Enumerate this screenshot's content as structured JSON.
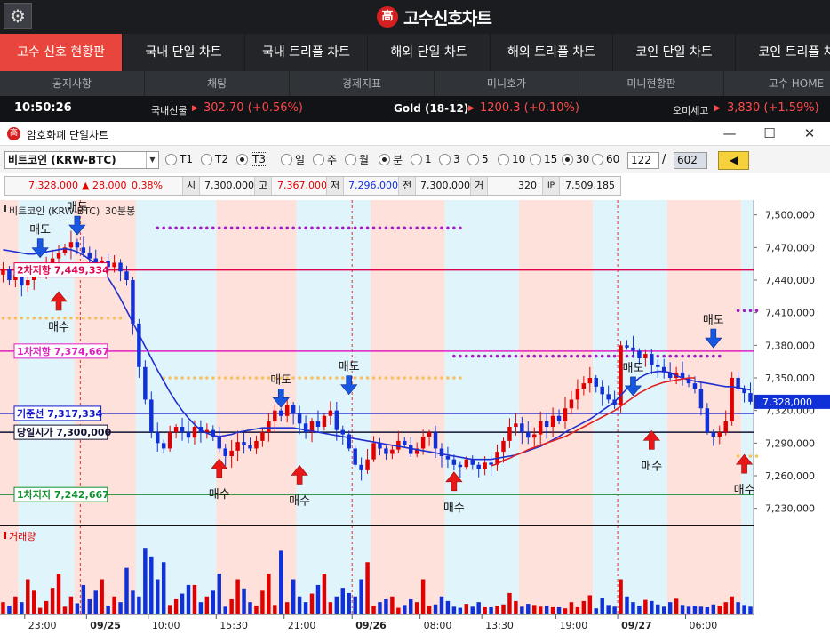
{
  "app": {
    "title": "고수신호차트",
    "logo_char": "高"
  },
  "menu": [
    {
      "label": "고수 신호 현황판",
      "active": true
    },
    {
      "label": "국내 단일 차트"
    },
    {
      "label": "국내 트리플 차트"
    },
    {
      "label": "해외 단일 차트"
    },
    {
      "label": "해외 트리플 차트"
    },
    {
      "label": "코인 단일 차트"
    },
    {
      "label": "코인 트리플 차"
    }
  ],
  "submenu": [
    "공지사항",
    "채팅",
    "경제지표",
    "미니호가",
    "미니현황판",
    "고수 HOME"
  ],
  "ticker": {
    "time": "10:50:26",
    "items": [
      {
        "label": "국내선물",
        "arrow": "▶",
        "value": "302.70 (+0.56%)"
      },
      {
        "label": "Gold (18-12)",
        "arrow": "▶",
        "value": "1200.3 (+0.10%)"
      },
      {
        "label": "오미세고",
        "arrow": "▶",
        "value": "3,830 (+1.59%)"
      }
    ]
  },
  "window": {
    "title": "암호화폐 단일차트",
    "icon_char": "高",
    "min": "—",
    "max": "☐",
    "close": "✕"
  },
  "toolbar": {
    "symbol": "비트코인 (KRW-BTC)",
    "dropdown": "▼",
    "ticks": [
      {
        "label": "T1"
      },
      {
        "label": "T2"
      },
      {
        "label": "T3",
        "checked": true
      }
    ],
    "periods": [
      {
        "label": "일"
      },
      {
        "label": "주"
      },
      {
        "label": "월"
      },
      {
        "label": "분",
        "checked": true
      }
    ],
    "minutes": [
      {
        "label": "1"
      },
      {
        "label": "3"
      },
      {
        "label": "5"
      },
      {
        "label": "10"
      },
      {
        "label": "15"
      },
      {
        "label": "30",
        "checked": true
      },
      {
        "label": "60"
      }
    ],
    "count": "122",
    "total": "602",
    "back": "◀"
  },
  "quote": {
    "price": "7,328,000",
    "change": "▲ 28,000",
    "pct": "0.38%",
    "open_label": "시",
    "open": "7,300,000",
    "high_label": "고",
    "high": "7,367,000",
    "low_label": "저",
    "low": "7,296,000",
    "prev_label": "전",
    "prev": "7,300,000",
    "vol_label": "거",
    "vol": "320",
    "amount_icon": "IP",
    "amount": "7,509,185"
  },
  "chart": {
    "legend_name": "비트코인 (KRW-BTC)",
    "legend_period": "30분봉",
    "volume_label": "거래량",
    "current_price_label": "7,328,000"
  },
  "colors": {
    "up": "#e00000",
    "down": "#1030d8",
    "ma": "#2030d0",
    "ma2": "#e02020",
    "resistance2": "#e00050",
    "resistance1": "#e020c0",
    "base": "#1018c8",
    "open": "#111133",
    "support1": "#109030",
    "shade_pink": "#fde1da",
    "shade_blue": "#e0f4fb"
  },
  "chart_data": {
    "type": "candlestick",
    "price_ylim": [
      7215000,
      7512000
    ],
    "price_ticks": [
      "7,500,000",
      "7,470,000",
      "7,440,000",
      "7,410,000",
      "7,380,000",
      "7,350,000",
      "7,320,000",
      "7,290,000",
      "7,260,000",
      "7,230,000"
    ],
    "x_labels": [
      {
        "i": 4,
        "label": "23:00",
        "bold": false
      },
      {
        "i": 14,
        "label": "09/25",
        "bold": true
      },
      {
        "i": 24,
        "label": "10:00",
        "bold": false
      },
      {
        "i": 35,
        "label": "15:30",
        "bold": false
      },
      {
        "i": 46,
        "label": "21:00",
        "bold": false
      },
      {
        "i": 57,
        "label": "09/26",
        "bold": true
      },
      {
        "i": 68,
        "label": "08:00",
        "bold": false
      },
      {
        "i": 78,
        "label": "13:30",
        "bold": false
      },
      {
        "i": 90,
        "label": "19:00",
        "bold": false
      },
      {
        "i": 100,
        "label": "09/27",
        "bold": true
      },
      {
        "i": 111,
        "label": "06:00",
        "bold": false
      }
    ],
    "closes": [
      7450000,
      7440000,
      7445000,
      7435000,
      7440000,
      7445000,
      7445000,
      7455000,
      7460000,
      7465000,
      7470000,
      7475000,
      7470000,
      7465000,
      7460000,
      7455000,
      7458000,
      7452000,
      7456000,
      7448000,
      7440000,
      7400000,
      7360000,
      7330000,
      7300000,
      7290000,
      7285000,
      7300000,
      7305000,
      7300000,
      7295000,
      7305000,
      7300000,
      7302000,
      7296000,
      7285000,
      7278000,
      7283000,
      7291000,
      7288000,
      7285000,
      7292000,
      7300000,
      7310000,
      7320000,
      7315000,
      7325000,
      7318000,
      7308000,
      7300000,
      7310000,
      7305000,
      7315000,
      7320000,
      7302000,
      7298000,
      7285000,
      7270000,
      7265000,
      7275000,
      7290000,
      7285000,
      7280000,
      7284000,
      7292000,
      7288000,
      7280000,
      7285000,
      7296000,
      7300000,
      7285000,
      7278000,
      7275000,
      7270000,
      7268000,
      7275000,
      7270000,
      7266000,
      7272000,
      7270000,
      7282000,
      7292000,
      7305000,
      7308000,
      7300000,
      7295000,
      7298000,
      7310000,
      7305000,
      7315000,
      7310000,
      7322000,
      7330000,
      7340000,
      7345000,
      7350000,
      7342000,
      7335000,
      7330000,
      7325000,
      7380000,
      7378000,
      7375000,
      7368000,
      7372000,
      7362000,
      7360000,
      7355000,
      7350000,
      7355000,
      7350000,
      7345000,
      7340000,
      7322000,
      7300000,
      7296000,
      7300000,
      7310000,
      7350000,
      7340000,
      7336000,
      7328000
    ],
    "ma": [
      7468000,
      7467000,
      7466000,
      7465000,
      7464000,
      7464000,
      7465000,
      7466000,
      7467000,
      7468000,
      7469000,
      7468000,
      7466000,
      7463000,
      7459000,
      7455000,
      7450000,
      7442000,
      7433000,
      7423000,
      7412000,
      7401000,
      7390000,
      7379000,
      7368000,
      7357000,
      7347000,
      7337000,
      7328000,
      7320000,
      7313000,
      7307000,
      7302000,
      7299000,
      7297000,
      7296000,
      7297000,
      7298000,
      7300000,
      7301000,
      7302000,
      7303000,
      7304000,
      7304000,
      7304000,
      7304000,
      7304000,
      7304000,
      7303000,
      7302000,
      7301000,
      7300000,
      7299000,
      7298000,
      7297000,
      7296000,
      7295000,
      7294000,
      7293000,
      7292000,
      7291000,
      7290000,
      7289000,
      7288000,
      7287000,
      7286000,
      7285000,
      7284000,
      7283000,
      7282000,
      7281000,
      7280000,
      7279000,
      7278000,
      7277000,
      7276000,
      7275000,
      7275000,
      7275000,
      7275000,
      7276000,
      7277000,
      7278000,
      7279000,
      7281000,
      7283000,
      7285000,
      7287000,
      7290000,
      7293000,
      7296000,
      7300000,
      7303000,
      7306000,
      7309000,
      7312000,
      7316000,
      7320000,
      7324000,
      7328000,
      7334000,
      7340000,
      7345000,
      7350000,
      7353000,
      7355000,
      7356000,
      7356000,
      7355000,
      7352000,
      7350000,
      7348000,
      7347000,
      7346000,
      7345000,
      7344000,
      7343000,
      7342000,
      7342000,
      7341000,
      7340000,
      7339000
    ],
    "ma2": [
      null,
      null,
      null,
      null,
      null,
      null,
      null,
      null,
      null,
      null,
      null,
      null,
      null,
      null,
      null,
      null,
      null,
      null,
      null,
      null,
      null,
      null,
      null,
      null,
      null,
      null,
      null,
      null,
      null,
      null,
      null,
      null,
      null,
      null,
      null,
      null,
      null,
      null,
      null,
      null,
      null,
      null,
      null,
      null,
      null,
      null,
      null,
      null,
      null,
      null,
      null,
      null,
      null,
      null,
      null,
      null,
      null,
      null,
      null,
      null,
      null,
      null,
      null,
      null,
      null,
      null,
      null,
      null,
      null,
      null,
      null,
      null,
      null,
      null,
      null,
      null,
      null,
      null,
      null,
      7269000,
      7271000,
      7274000,
      7276000,
      7279000,
      7281000,
      7284000,
      7286000,
      7288000,
      7290000,
      7292000,
      7294000,
      7296000,
      7299000,
      7302000,
      7305000,
      7308000,
      7311000,
      7314000,
      7317000,
      7320000,
      7324000,
      7328000,
      7332000,
      7336000,
      7339000,
      7342000,
      7344000,
      7346000,
      7347000,
      7348000,
      7349000,
      7350000,
      7350000,
      null,
      null,
      null,
      null,
      null,
      null,
      null,
      null,
      null
    ],
    "volumes": [
      20,
      14,
      30,
      20,
      60,
      40,
      10,
      22,
      45,
      70,
      12,
      30,
      18,
      50,
      25,
      40,
      60,
      14,
      30,
      20,
      80,
      40,
      30,
      115,
      100,
      60,
      90,
      15,
      25,
      35,
      50,
      50,
      20,
      30,
      40,
      70,
      12,
      25,
      60,
      44,
      20,
      14,
      40,
      70,
      15,
      110,
      20,
      60,
      30,
      20,
      35,
      50,
      70,
      20,
      30,
      45,
      36,
      30,
      60,
      90,
      14,
      20,
      25,
      30,
      10,
      15,
      25,
      20,
      60,
      14,
      16,
      30,
      22,
      12,
      10,
      17,
      12,
      20,
      11,
      11,
      14,
      16,
      36,
      22,
      12,
      17,
      15,
      12,
      14,
      11,
      11,
      9,
      20,
      11,
      22,
      32,
      9,
      28,
      15,
      12,
      60,
      30,
      20,
      14,
      24,
      22,
      16,
      12,
      20,
      26,
      15,
      12,
      14,
      12,
      11,
      16,
      14,
      20,
      30,
      20,
      15,
      12
    ],
    "vol_max": 120,
    "levels": [
      {
        "label": "2차저항 7,449,334",
        "value": 7449334,
        "key": "resistance2"
      },
      {
        "label": "1차저항 7,374,667",
        "value": 7374667,
        "key": "resistance1"
      },
      {
        "label": "기준선 7,317,334",
        "value": 7317334,
        "key": "base"
      },
      {
        "label": "당일시가 7,300,000",
        "value": 7300000,
        "key": "open"
      },
      {
        "label": "1차지지 7,242,667",
        "value": 7242667,
        "key": "support1"
      }
    ],
    "dotted": [
      {
        "from": 0,
        "to": 19,
        "value": 7405000,
        "color": "#f8c060"
      },
      {
        "from": 25,
        "to": 74,
        "value": 7488000,
        "color": "#a020c0"
      },
      {
        "from": 26,
        "to": 74,
        "value": 7350000,
        "color": "#f8c060"
      },
      {
        "from": 73,
        "to": 116,
        "value": 7370000,
        "color": "#a020c0"
      },
      {
        "from": 119,
        "to": 122,
        "value": 7412000,
        "color": "#a020c0"
      },
      {
        "from": 119,
        "to": 122,
        "value": 7278000,
        "color": "#f8c060"
      }
    ],
    "shades": [
      {
        "from": 0,
        "to": 3,
        "kind": "pink"
      },
      {
        "from": 3,
        "to": 12,
        "kind": "blue"
      },
      {
        "from": 12,
        "to": 22,
        "kind": "pink"
      },
      {
        "from": 22,
        "to": 35,
        "kind": "blue"
      },
      {
        "from": 35,
        "to": 48,
        "kind": "pink"
      },
      {
        "from": 48,
        "to": 60,
        "kind": "blue"
      },
      {
        "from": 60,
        "to": 72,
        "kind": "pink"
      },
      {
        "from": 72,
        "to": 84,
        "kind": "blue"
      },
      {
        "from": 84,
        "to": 96,
        "kind": "pink"
      },
      {
        "from": 96,
        "to": 108,
        "kind": "blue"
      },
      {
        "from": 108,
        "to": 120,
        "kind": "pink"
      },
      {
        "from": 120,
        "to": 122,
        "kind": "blue"
      }
    ],
    "day_lines": [
      13,
      57,
      100
    ],
    "signals": [
      {
        "i": 6,
        "type": "sell",
        "label": "매도",
        "value": 7455000
      },
      {
        "i": 12,
        "type": "sell",
        "label": "매도",
        "value": 7476000
      },
      {
        "i": 9,
        "type": "buy",
        "label": "매수",
        "value": 7436000
      },
      {
        "i": 35,
        "type": "buy",
        "label": "매수",
        "value": 7282000
      },
      {
        "i": 45,
        "type": "sell",
        "label": "매도",
        "value": 7317000
      },
      {
        "i": 48,
        "type": "buy",
        "label": "매수",
        "value": 7276000
      },
      {
        "i": 56,
        "type": "sell",
        "label": "매도",
        "value": 7329000
      },
      {
        "i": 73,
        "type": "buy",
        "label": "매수",
        "value": 7270000
      },
      {
        "i": 102,
        "type": "sell",
        "label": "매도",
        "value": 7328000
      },
      {
        "i": 105,
        "type": "buy",
        "label": "매수",
        "value": 7308000
      },
      {
        "i": 115,
        "type": "sell",
        "label": "매도",
        "value": 7372000
      },
      {
        "i": 120,
        "type": "buy",
        "label": "매수",
        "value": 7286000
      }
    ]
  }
}
